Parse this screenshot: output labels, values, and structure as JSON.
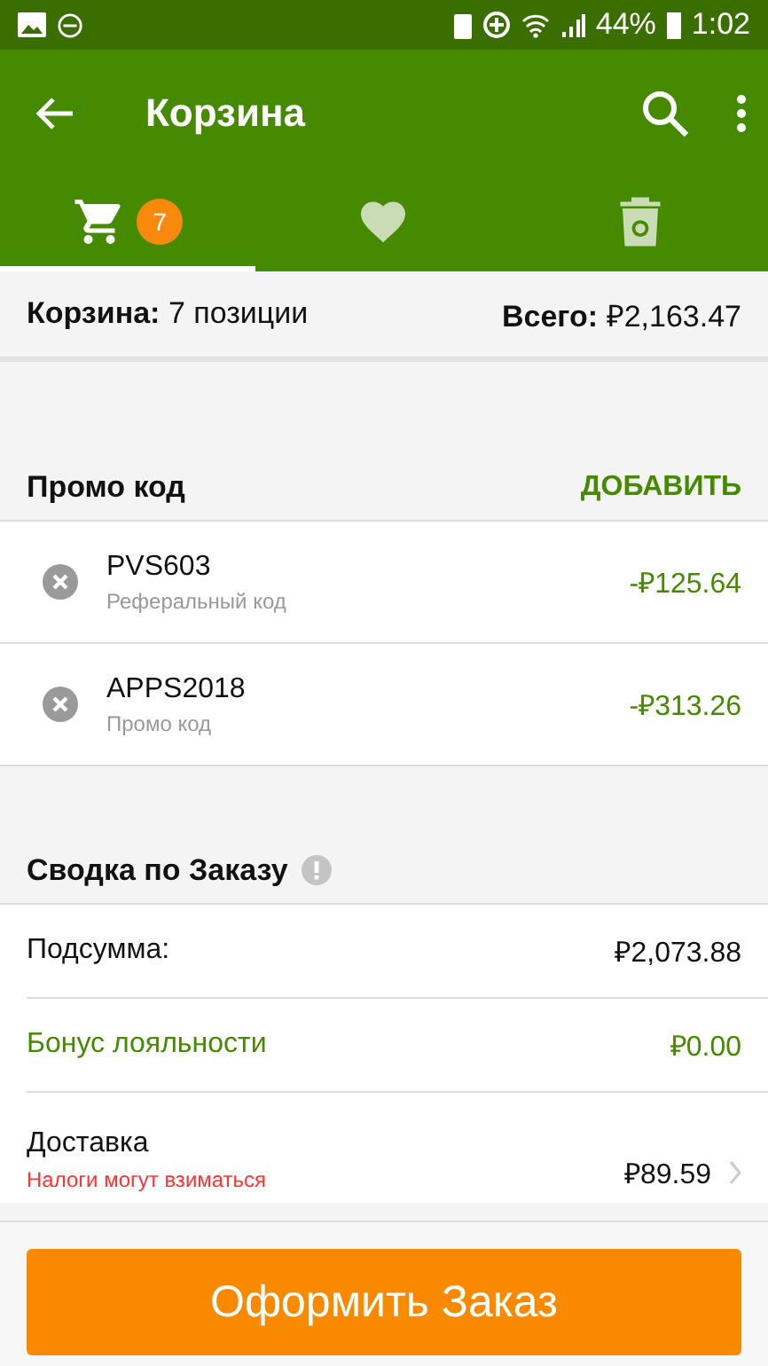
{
  "status_bar": {
    "battery": "44%",
    "time": "1:02"
  },
  "toolbar": {
    "title": "Корзина"
  },
  "tabs": [
    {
      "kind": "cart",
      "badge": "7",
      "selected": true
    },
    {
      "kind": "heart",
      "selected": false
    },
    {
      "kind": "trash",
      "selected": false
    }
  ],
  "cart_summary": {
    "count": "**Корзина:** 7 позиции",
    "total": "**Всего:** ₽2,163.47"
  },
  "promo": {
    "title": "Промо код",
    "action": "ДОБАВИТЬ",
    "codes": [
      {
        "code": "PVS603",
        "type": "Реферальный код",
        "amount": "-₽125.64"
      },
      {
        "code": "APPS2018",
        "type": "Промо код",
        "amount": "-₽313.26"
      }
    ]
  },
  "order_summary": {
    "title": "Сводка по Заказу",
    "rows": [
      {
        "kind": "plain",
        "label": "Подсумма:",
        "value": "₽2,073.88"
      },
      {
        "kind": "bonus",
        "label": "Бонус лояльности",
        "value": "₽0.00"
      },
      {
        "kind": "shipping",
        "label": "Доставка",
        "note": "Налоги могут взиматься",
        "value": "₽89.59"
      }
    ]
  },
  "checkout_button": "Оформить Заказ"
}
